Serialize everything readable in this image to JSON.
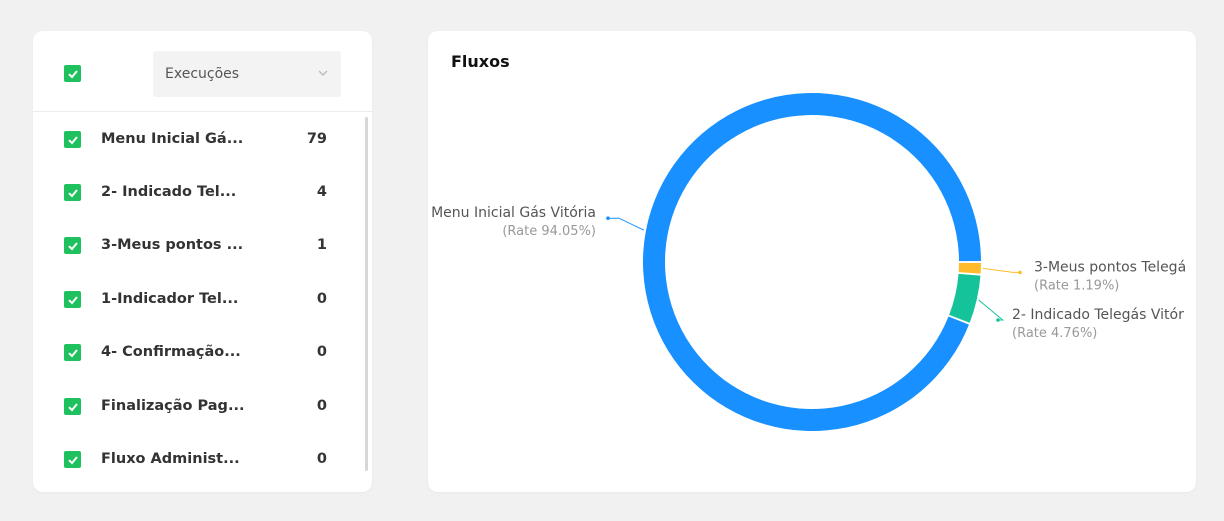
{
  "filter_panel": {
    "metric_select": {
      "value": "Execuções"
    },
    "items": [
      {
        "label": "Menu Inicial Gá...",
        "count": "79"
      },
      {
        "label": "2- Indicado Tel...",
        "count": "4"
      },
      {
        "label": "3-Meus pontos ...",
        "count": "1"
      },
      {
        "label": "1-Indicador Tel...",
        "count": "0"
      },
      {
        "label": "4- Confirmação...",
        "count": "0"
      },
      {
        "label": "Finalização Pag...",
        "count": "0"
      },
      {
        "label": "Fluxo Administ...",
        "count": "0"
      }
    ]
  },
  "chart_panel": {
    "title": "Fluxos"
  },
  "colors": {
    "checkbox": "#1ec15d",
    "slice1": "#1890ff",
    "slice2": "#15c39a",
    "slice3": "#ffbb2b"
  },
  "chart_data": {
    "type": "pie",
    "title": "Fluxos",
    "slices": [
      {
        "label": "Menu Inicial Gás Vitória",
        "rate_label": "(Rate 94.05%)",
        "value": 79,
        "color": "#1890ff"
      },
      {
        "label": "2- Indicado Telegás Vitór",
        "rate_label": "(Rate 4.76%)",
        "value": 4,
        "color": "#15c39a"
      },
      {
        "label": "3-Meus pontos Telegá",
        "rate_label": "(Rate 1.19%)",
        "value": 1,
        "color": "#ffbb2b"
      }
    ]
  }
}
